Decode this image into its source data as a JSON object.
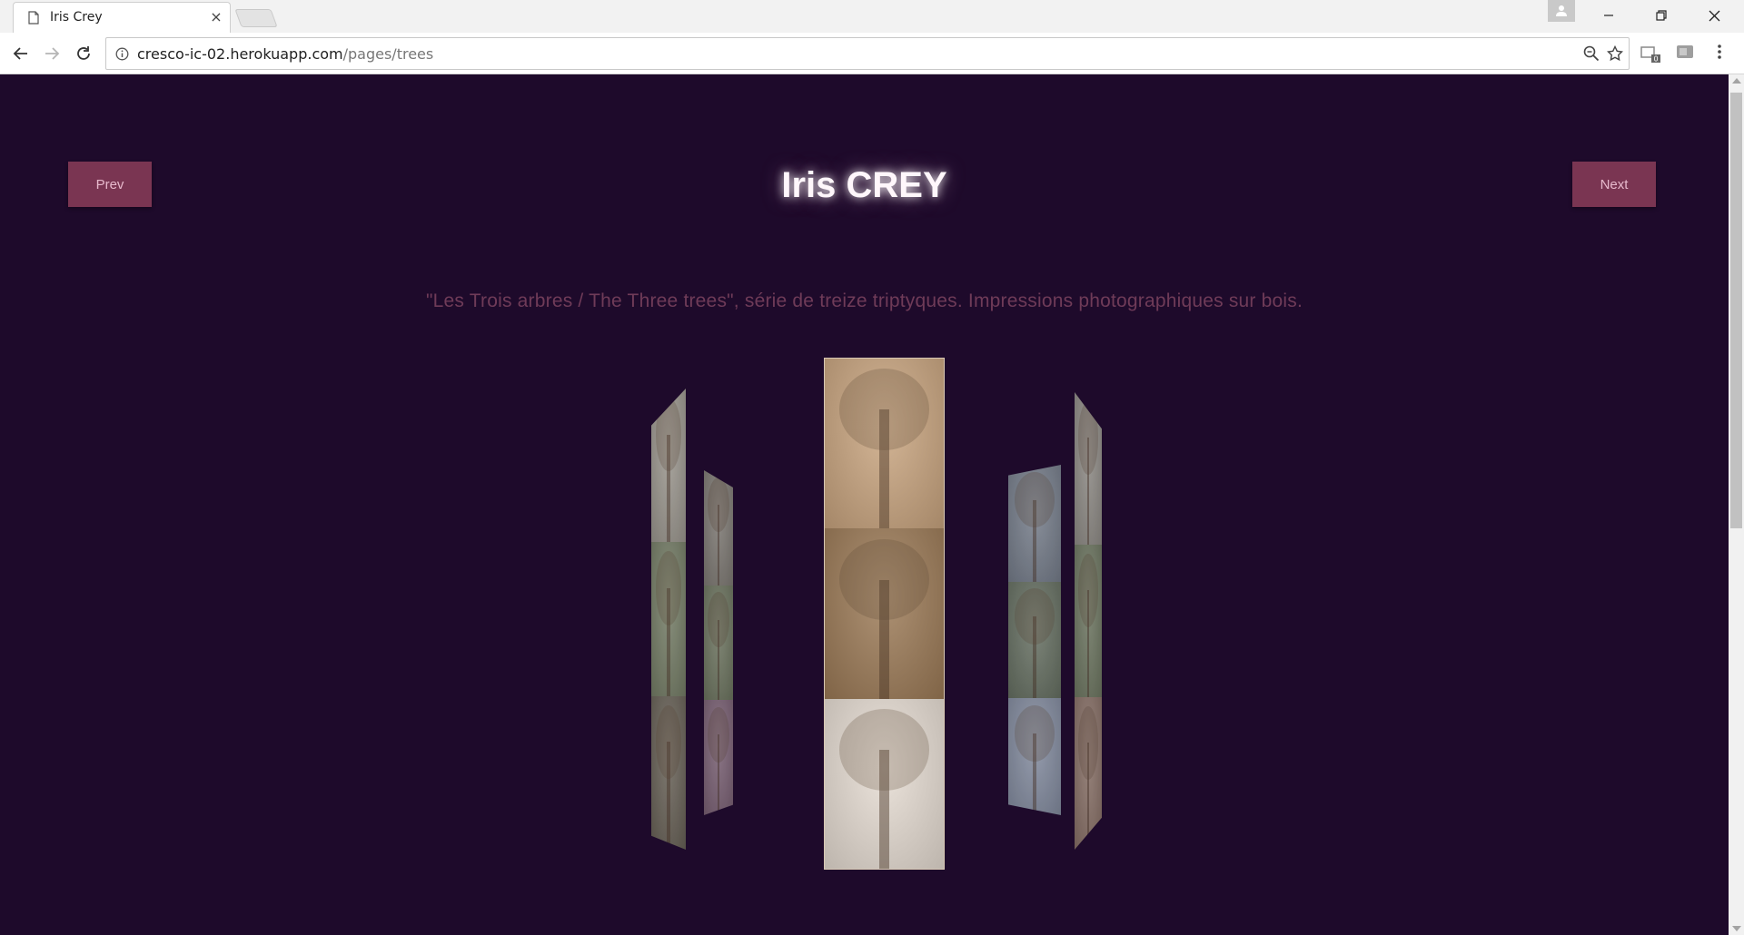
{
  "browser": {
    "tab_title": "Iris Crey",
    "tab_close": "×",
    "url_host": "cresco-ic-02.herokuapp.com",
    "url_path": "/pages/trees",
    "ext_badge": "0"
  },
  "page": {
    "title": "Iris CREY",
    "prev_label": "Prev",
    "next_label": "Next",
    "subtitle": "\"Les Trois arbres / The Three trees\", série de treize triptyques. Impressions photographiques sur bois.",
    "background": "#1e0a2b",
    "button_color": "#7a3552"
  },
  "gallery": {
    "panels": [
      {
        "name": "left-outer",
        "segments": [
          "#a9a79a",
          "#7e8a6c",
          "#6f6a5a"
        ]
      },
      {
        "name": "left-inner",
        "segments": [
          "#8f8e80",
          "#7a8868",
          "#8a7080"
        ]
      },
      {
        "name": "center",
        "segments": [
          "#c9a57f",
          "#9c7a56",
          "#e6ddd3"
        ]
      },
      {
        "name": "right-inner",
        "segments": [
          "#7f8a95",
          "#6e7b68",
          "#8e9aac"
        ]
      },
      {
        "name": "right-outer",
        "segments": [
          "#a3a396",
          "#7b8a6a",
          "#9a8270"
        ]
      }
    ]
  }
}
